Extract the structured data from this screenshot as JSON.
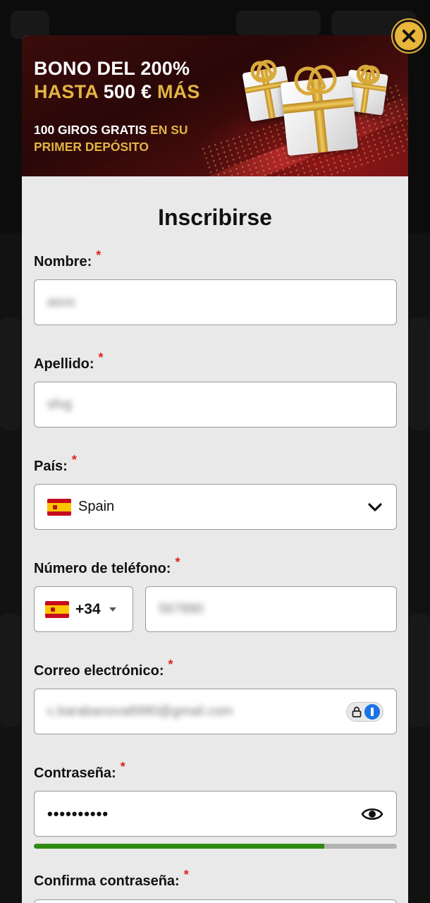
{
  "banner": {
    "line1": "BONO DEL 200%",
    "line2_hasta": "HASTA",
    "line2_amount": "500 €",
    "line2_mas": "MÁS",
    "sub1_white": "100 GIROS GRATIS",
    "sub1_gold": "EN SU",
    "sub2_gold": "PRIMER DEPÓSITO"
  },
  "form": {
    "title": "Inscribirse",
    "required_mark": "*",
    "nombre": {
      "label": "Nombre:",
      "value": "asvs"
    },
    "apellido": {
      "label": "Apellido:",
      "value": "sfvg"
    },
    "pais": {
      "label": "País:",
      "value": "Spain"
    },
    "telefono": {
      "label": "Número de teléfono:",
      "code": "+34",
      "value": "567890"
    },
    "correo": {
      "label": "Correo electrónico:",
      "value": "c.barabanova8990@gmail.com"
    },
    "contrasena": {
      "label": "Contraseña:",
      "value": "••••••••••",
      "strength": 0.8
    },
    "confirma": {
      "label": "Confirma contraseña:"
    }
  },
  "colors": {
    "accent_gold": "#e2b443",
    "required_red": "#e02424",
    "strength_green": "#2f8a12",
    "close_yellow": "#e9b53a"
  },
  "icons": {
    "close": "close-icon",
    "chevron": "chevron-down-icon",
    "caret": "caret-down-icon",
    "password_manager": "password-manager-icon",
    "eye": "eye-icon",
    "flag": "spain-flag-icon"
  }
}
